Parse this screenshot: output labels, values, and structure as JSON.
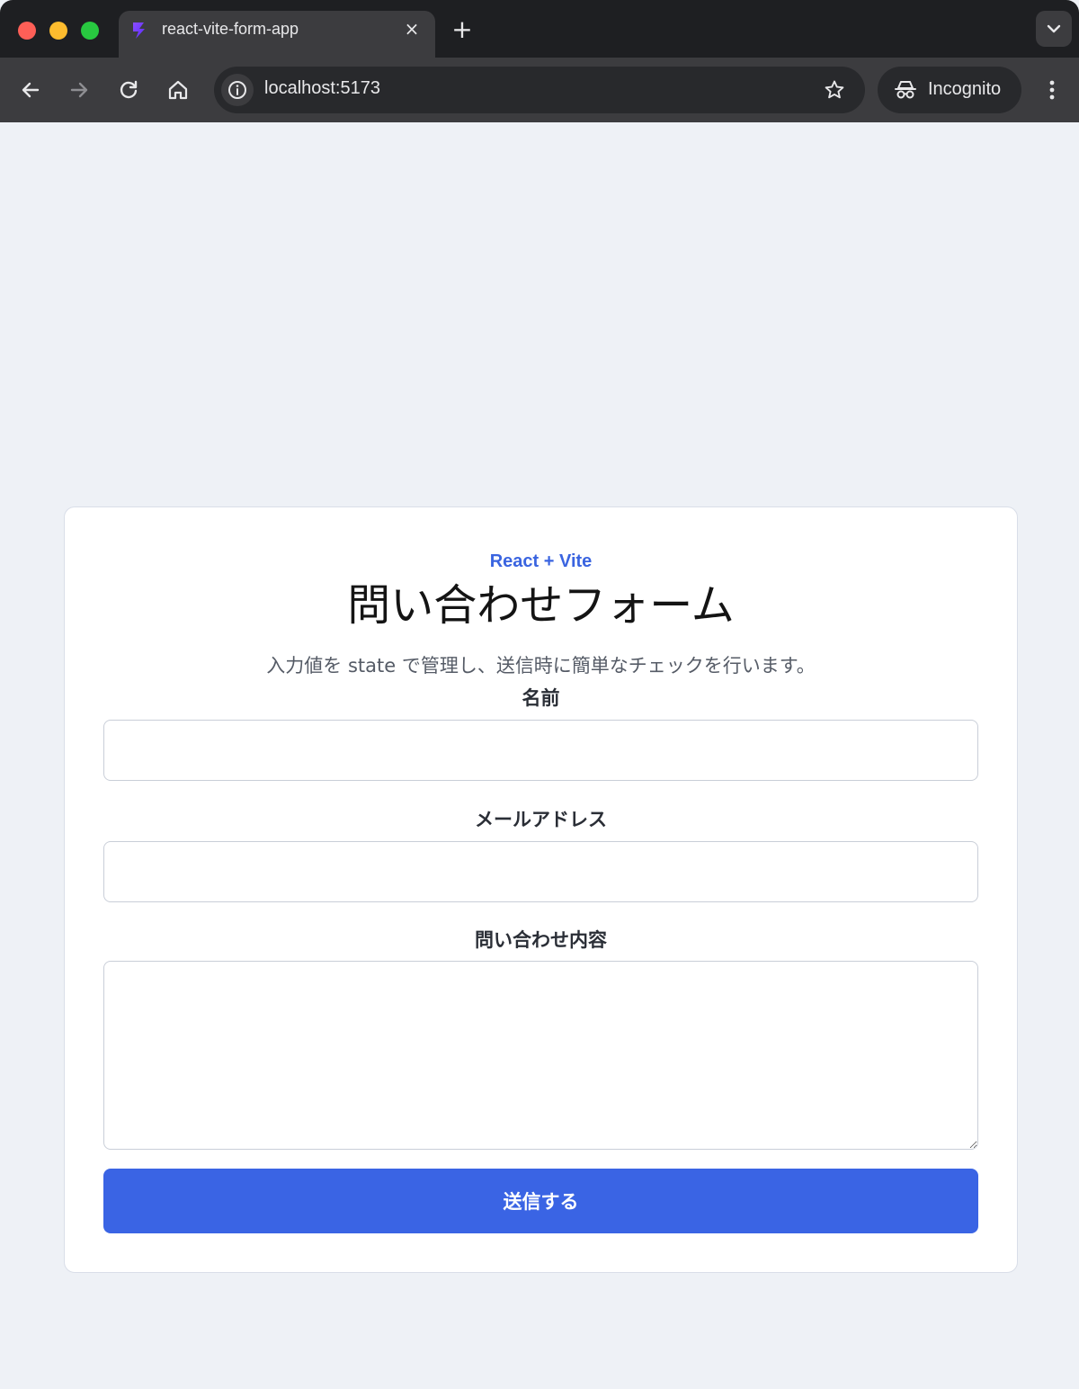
{
  "browser": {
    "tab": {
      "title": "react-vite-form-app",
      "close_glyph": "×",
      "favicon": "vite-logo-icon"
    },
    "new_tab_glyph": "+",
    "address": {
      "url": "localhost:5173"
    },
    "incognito_label": "Incognito"
  },
  "page": {
    "eyebrow": "React + Vite",
    "title": "問い合わせフォーム",
    "description": "入力値を state で管理し、送信時に簡単なチェックを行います。",
    "fields": {
      "name": {
        "label": "名前",
        "value": ""
      },
      "email": {
        "label": "メールアドレス",
        "value": ""
      },
      "message": {
        "label": "問い合わせ内容",
        "value": ""
      }
    },
    "submit_label": "送信する"
  },
  "colors": {
    "accent": "#3a64e4",
    "page_background": "#eef1f6",
    "card_background": "#ffffff",
    "chrome_dark": "#1e1f22",
    "chrome_toolbar": "#3c3c3f"
  }
}
